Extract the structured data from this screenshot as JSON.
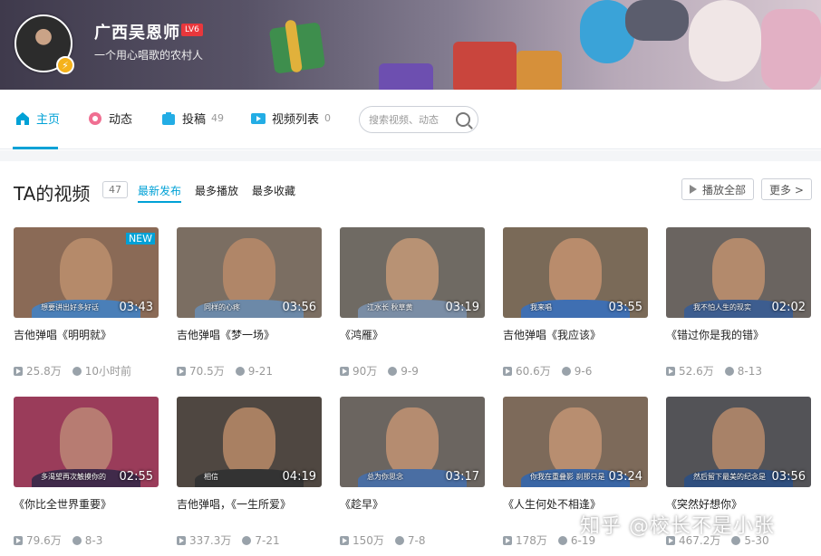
{
  "header": {
    "username": "广西吴恩师",
    "level_badge": "LV6",
    "signature": "一个用心唱歌的农村人",
    "verify_icon": "lightning-icon"
  },
  "nav": {
    "tabs": [
      {
        "label": "主页",
        "count": "",
        "icon": "home-icon"
      },
      {
        "label": "动态",
        "count": "",
        "icon": "flower-icon"
      },
      {
        "label": "投稿",
        "count": "49",
        "icon": "upload-icon"
      },
      {
        "label": "视频列表",
        "count": "0",
        "icon": "tv-icon"
      }
    ],
    "search_placeholder": "搜索视频、动态"
  },
  "section": {
    "title": "TA的视频",
    "count": "47",
    "sorts": [
      "最新发布",
      "最多播放",
      "最多收藏"
    ],
    "play_all": "播放全部",
    "more": "更多 >"
  },
  "videos": [
    {
      "title": "吉他弹唱《明明就》",
      "duration": "03:43",
      "plays": "25.8万",
      "date": "10小时前",
      "new": "NEW",
      "subtitle": "想要讲出好多好话"
    },
    {
      "title": "吉他弹唱《梦一场》",
      "duration": "03:56",
      "plays": "70.5万",
      "date": "9-21",
      "new": "",
      "subtitle": "同样的心疼"
    },
    {
      "title": "《鸿雁》",
      "duration": "03:19",
      "plays": "90万",
      "date": "9-9",
      "new": "",
      "subtitle": "江水长 秋草黄"
    },
    {
      "title": "吉他弹唱《我应该》",
      "duration": "03:55",
      "plays": "60.6万",
      "date": "9-6",
      "new": "",
      "subtitle": "我来唱"
    },
    {
      "title": "《错过你是我的错》",
      "duration": "02:02",
      "plays": "52.6万",
      "date": "8-13",
      "new": "",
      "subtitle": "我不怕人生的现实"
    },
    {
      "title": "《你比全世界重要》",
      "duration": "02:55",
      "plays": "79.6万",
      "date": "8-3",
      "new": "",
      "subtitle": "多渴望再次触摸你的"
    },
    {
      "title": "吉他弹唱，《一生所爱》",
      "duration": "04:19",
      "plays": "337.3万",
      "date": "7-21",
      "new": "",
      "subtitle": "相信"
    },
    {
      "title": "《趁早》",
      "duration": "03:17",
      "plays": "150万",
      "date": "7-8",
      "new": "",
      "subtitle": "总为你思念"
    },
    {
      "title": "《人生何处不相逢》",
      "duration": "03:24",
      "plays": "178万",
      "date": "6-19",
      "new": "",
      "subtitle": "你我在重叠影 刹那只是"
    },
    {
      "title": "《突然好想你》",
      "duration": "03:56",
      "plays": "467.2万",
      "date": "5-30",
      "new": "",
      "subtitle": "然后留下最美的纪念是"
    }
  ],
  "watermark": "知乎 @校长不是小张",
  "colors": {
    "accent": "#00a1d6",
    "level_badge": "#e8373c",
    "verify": "#f5b21b"
  }
}
